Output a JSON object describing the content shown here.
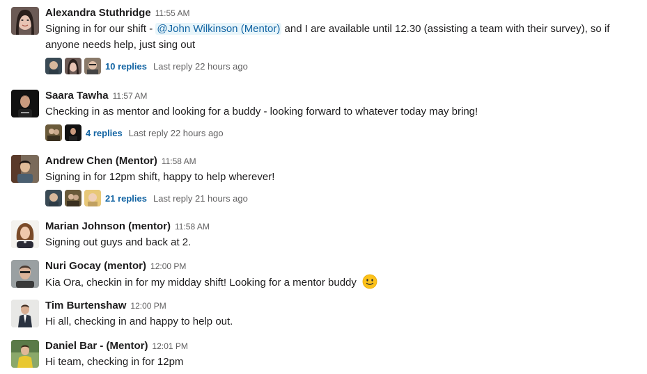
{
  "messages": [
    {
      "author": "Alexandra Stuthridge",
      "time": "11:55 AM",
      "text_before": "Signing in for our shift - ",
      "mention": "@John Wilkinson (Mentor)",
      "text_after": " and I are available until 12.30 (assisting a team with their survey), so if anyone needs help, just sing out",
      "replies": "10 replies",
      "last_reply": "Last reply 22 hours ago"
    },
    {
      "author": "Saara Tawha",
      "time": "11:57 AM",
      "text": "Checking in as mentor and looking for a buddy - looking forward to whatever today may bring!",
      "replies": "4 replies",
      "last_reply": "Last reply 22 hours ago"
    },
    {
      "author": "Andrew Chen (Mentor)",
      "time": "11:58 AM",
      "text": "Signing in for 12pm shift, happy to help wherever!",
      "replies": "21 replies",
      "last_reply": "Last reply 21 hours ago"
    },
    {
      "author": "Marian Johnson (mentor)",
      "time": "11:58 AM",
      "text": "Signing out guys and back at 2."
    },
    {
      "author": "Nuri Gocay (mentor)",
      "time": "12:00 PM",
      "text": "Kia Ora, checkin in for my midday shift! Looking for a mentor buddy",
      "emoji": "slightly-smiling-face-icon"
    },
    {
      "author": "Tim Burtenshaw",
      "time": "12:00 PM",
      "text": "Hi all, checking in and happy to help out."
    },
    {
      "author": "Daniel Bar - (Mentor)",
      "time": "12:01 PM",
      "text": "Hi team, checking in for 12pm"
    }
  ],
  "colors": {
    "link": "#1264a3",
    "mention_bg": "#e8f5fa",
    "muted": "#616061",
    "text": "#1d1c1d"
  }
}
